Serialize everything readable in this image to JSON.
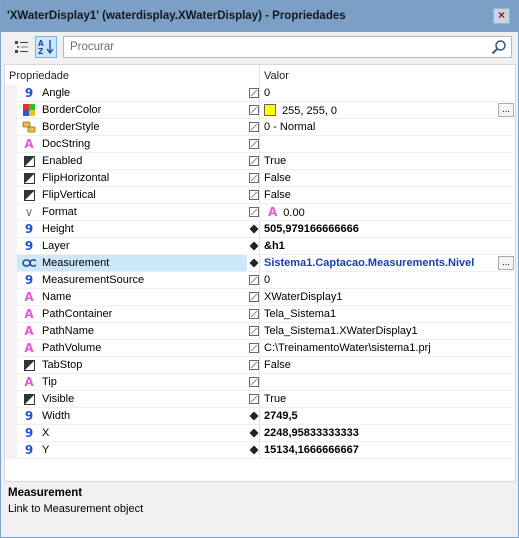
{
  "window": {
    "title": "'XWaterDisplay1' (waterdisplay.XWaterDisplay) - Propriedades",
    "close_glyph": "×"
  },
  "toolbar": {
    "search_placeholder": "Procurar"
  },
  "grid": {
    "header_property": "Propriedade",
    "header_value": "Valor",
    "rows": [
      {
        "icon": "number",
        "name": "Angle",
        "mark": "edit",
        "value": "0",
        "style": ""
      },
      {
        "icon": "color",
        "name": "BorderColor",
        "mark": "edit",
        "value": "255, 255, 0",
        "style": "",
        "swatch": "#ffff00",
        "ellipsis": "..."
      },
      {
        "icon": "enum",
        "name": "BorderStyle",
        "mark": "edit",
        "value": "0 - Normal",
        "style": ""
      },
      {
        "icon": "text",
        "name": "DocString",
        "mark": "edit",
        "value": "",
        "style": ""
      },
      {
        "icon": "bool",
        "name": "Enabled",
        "mark": "edit",
        "value": "True",
        "style": ""
      },
      {
        "icon": "bool",
        "name": "FlipHorizontal",
        "mark": "edit",
        "value": "False",
        "style": ""
      },
      {
        "icon": "bool",
        "name": "FlipVertical",
        "mark": "edit",
        "value": "False",
        "style": ""
      },
      {
        "icon": "format",
        "name": "Format",
        "mark": "edit",
        "value": "0.00",
        "style": "",
        "value_icon": "text"
      },
      {
        "icon": "number",
        "name": "Height",
        "mark": "diamond",
        "value": "505,979166666666",
        "style": "bold"
      },
      {
        "icon": "number",
        "name": "Layer",
        "mark": "diamond",
        "value": "&h1",
        "style": "bold"
      },
      {
        "icon": "link",
        "name": "Measurement",
        "mark": "diamond",
        "value": "Sistema1.Captacao.Measurements.Nivel",
        "style": "link",
        "ellipsis": "...",
        "selected": true
      },
      {
        "icon": "number",
        "name": "MeasurementSource",
        "mark": "edit",
        "value": "0",
        "style": ""
      },
      {
        "icon": "text",
        "name": "Name",
        "mark": "edit",
        "value": "XWaterDisplay1",
        "style": ""
      },
      {
        "icon": "text",
        "name": "PathContainer",
        "mark": "edit",
        "value": "Tela_Sistema1",
        "style": ""
      },
      {
        "icon": "text",
        "name": "PathName",
        "mark": "edit",
        "value": "Tela_Sistema1.XWaterDisplay1",
        "style": ""
      },
      {
        "icon": "text",
        "name": "PathVolume",
        "mark": "edit",
        "value": "C:\\TreinamentoWater\\sistema1.prj",
        "style": ""
      },
      {
        "icon": "bool",
        "name": "TabStop",
        "mark": "edit",
        "value": "False",
        "style": ""
      },
      {
        "icon": "text",
        "name": "Tip",
        "mark": "edit",
        "value": "",
        "style": ""
      },
      {
        "icon": "bool",
        "name": "Visible",
        "mark": "edit",
        "value": "True",
        "style": ""
      },
      {
        "icon": "number",
        "name": "Width",
        "mark": "diamond",
        "value": "2749,5",
        "style": "bold"
      },
      {
        "icon": "number",
        "name": "X",
        "mark": "diamond",
        "value": "2248,95833333333",
        "style": "bold"
      },
      {
        "icon": "number",
        "name": "Y",
        "mark": "diamond",
        "value": "15134,1666666667",
        "style": "bold"
      }
    ]
  },
  "description": {
    "title": "Measurement",
    "text": "Link to Measurement object"
  },
  "colors": {
    "titlebar": "#7b9fc5",
    "selection": "#cde8fb",
    "link_value": "#1b3db0",
    "number_icon": "#2451d6",
    "text_icon": "#e05bd4"
  }
}
